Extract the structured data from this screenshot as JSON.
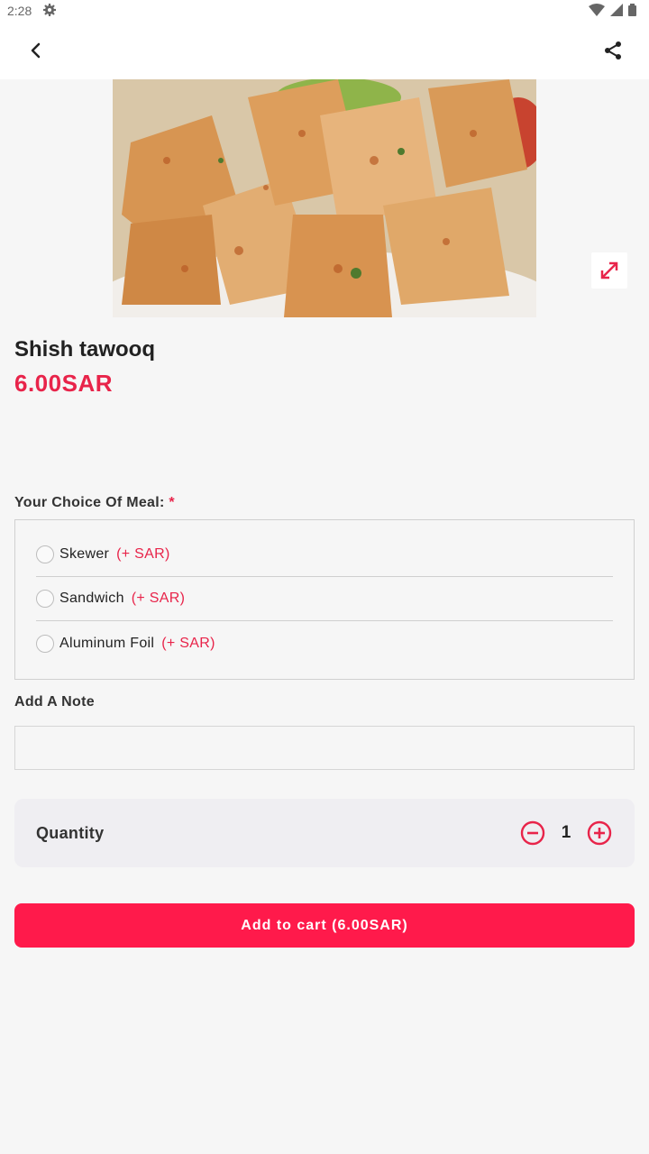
{
  "status_bar": {
    "time": "2:28"
  },
  "colors": {
    "accent": "#e8244a",
    "cart_button": "#ff1a4b",
    "background": "#f6f6f6"
  },
  "icons": {
    "back": "chevron-left-icon",
    "share": "share-icon",
    "expand": "expand-icon",
    "minus": "minus-circle-icon",
    "plus": "plus-circle-icon"
  },
  "product": {
    "name": "Shish tawooq",
    "price": "6.00SAR"
  },
  "meal_choice": {
    "label": "Your Choice Of Meal:",
    "required_mark": "*",
    "options": [
      {
        "label": "Skewer",
        "extra": "(+ SAR)"
      },
      {
        "label": "Sandwich",
        "extra": "(+ SAR)"
      },
      {
        "label": "Aluminum Foil",
        "extra": "(+ SAR)"
      }
    ]
  },
  "note": {
    "label": "Add A Note",
    "value": "",
    "placeholder": ""
  },
  "quantity": {
    "label": "Quantity",
    "value": "1"
  },
  "cart_button": {
    "label": "Add to cart (6.00SAR)"
  }
}
